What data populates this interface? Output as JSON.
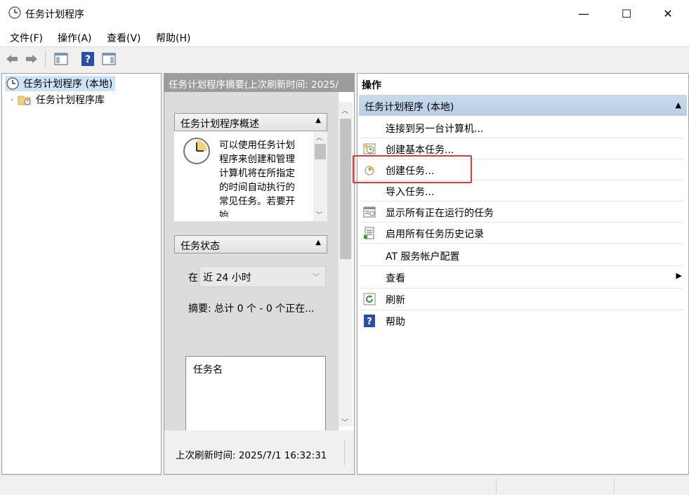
{
  "window": {
    "title": "任务计划程序",
    "controls": {
      "minimize": "—",
      "maximize": "☐",
      "close": "✕"
    }
  },
  "menu": [
    "文件(F)",
    "操作(A)",
    "查看(V)",
    "帮助(H)"
  ],
  "tree": {
    "root": "任务计划程序 (本地)",
    "child": "任务计划程序库"
  },
  "middle": {
    "header": "任务计划程序摘要(上次刷新时间: 2025/",
    "overview_title": "任务计划程序概述",
    "overview_text": "可以使用任务计划程序来创建和管理计算机将在所指定的时间自动执行的常见任务。若要开始",
    "status_title": "任务状态",
    "status_prefix": "在",
    "status_select": "近 24 小时",
    "summary": "摘要: 总计 0 个 - 0 个正在...",
    "task_name_header": "任务名",
    "footer": "上次刷新时间: 2025/7/1 16:32:31"
  },
  "actions": {
    "title": "操作",
    "section": "任务计划程序 (本地)",
    "items": [
      {
        "label": "连接到另一台计算机...",
        "icon": "none"
      },
      {
        "label": "创建基本任务...",
        "icon": "basic-task-icon"
      },
      {
        "label": "创建任务...",
        "icon": "create-task-icon"
      },
      {
        "label": "导入任务...",
        "icon": "none"
      },
      {
        "label": "显示所有正在运行的任务",
        "icon": "running-tasks-icon"
      },
      {
        "label": "启用所有任务历史记录",
        "icon": "history-icon"
      },
      {
        "label": "AT 服务帐户配置",
        "icon": "none"
      },
      {
        "label": "查看",
        "icon": "none"
      },
      {
        "label": "刷新",
        "icon": "refresh-icon"
      },
      {
        "label": "帮助",
        "icon": "help-icon"
      }
    ]
  },
  "colors": {
    "highlight": "#e03a3a",
    "section_bg": "#c8dbef",
    "header_bg": "#9c9c9c"
  }
}
